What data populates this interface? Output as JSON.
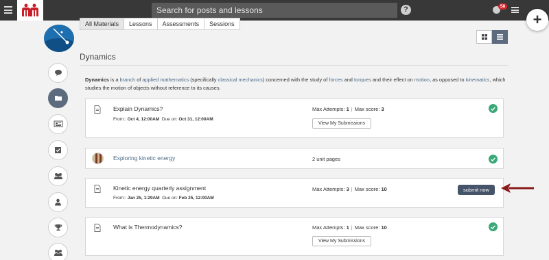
{
  "header": {
    "search_placeholder": "Search for posts and lessons",
    "help_label": "?",
    "notification_count": "58"
  },
  "tabs": [
    "All Materials",
    "Lessons",
    "Assessments",
    "Sessions"
  ],
  "page": {
    "title": "Dynamics"
  },
  "description": {
    "term": "Dynamics",
    "t1": " is a ",
    "l1": "branch",
    "t2": " of ",
    "l2": "applied mathematics",
    "t3": " (specifically ",
    "l3": "classical mechanics",
    "t4": ") concerned with the study of ",
    "l4": "forces",
    "t5": " and ",
    "l5": "torques",
    "t6": " and their effect on ",
    "l6": "motion",
    "t7": ", as opposed to ",
    "l7": "kinematics",
    "t8": ", which studies the motion of objects without reference to its causes."
  },
  "items": [
    {
      "title": "Explain Dynamics?",
      "from_label": "From:: ",
      "from": "Oct 4, 12:00AM",
      "due_label": "Due on: ",
      "due": "Oct 31, 12:00AM",
      "max_attempts_label": "Max Attempts: ",
      "max_attempts": "1",
      "sep": "|",
      "max_score_label": "Max score: ",
      "max_score": "3",
      "button": "View My Submissions",
      "status": "completed"
    },
    {
      "title": "Exploring kinetic energy",
      "meta": "2 unit pages",
      "status": "completed"
    },
    {
      "title": "Kinetic energy quarterly assignment",
      "from_label": "From:: ",
      "from": "Jan 25, 1:29AM",
      "due_label": "Due on: ",
      "due": "Feb 25, 12:00AM",
      "max_attempts_label": "Max Attempts: ",
      "max_attempts": "3",
      "sep": "|",
      "max_score_label": "Max score: ",
      "max_score": "10",
      "button": "submit now",
      "status": "pending"
    },
    {
      "title": "What is Thermodynamics?",
      "max_attempts_label": "Max Attempts: ",
      "max_attempts": "1",
      "sep": "|",
      "max_score_label": "Max score: ",
      "max_score": "10",
      "button": "View My Submissions",
      "status": "completed"
    }
  ],
  "colors": {
    "topbar": "#383838",
    "accent": "#5c6b7e",
    "success": "#3aa877",
    "link": "#4b6b8a",
    "badge": "#d9262c",
    "arrow": "#8b1a1a"
  },
  "icons": {
    "sidebar": [
      "chat-icon",
      "folder-icon",
      "news-icon",
      "checkbox-icon",
      "group-icon",
      "user-icon",
      "trophy-icon",
      "group-icon"
    ]
  }
}
